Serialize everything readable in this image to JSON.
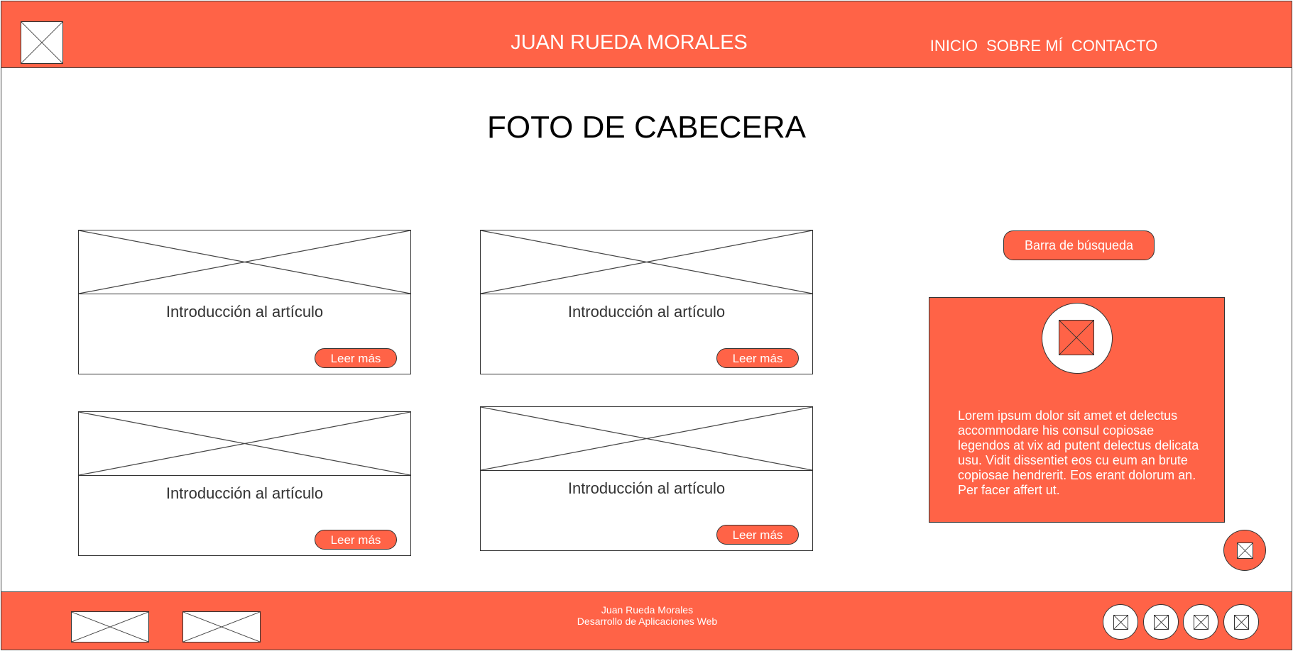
{
  "header": {
    "title": "JUAN RUEDA MORALES",
    "nav": [
      "INICIO",
      "SOBRE MÍ",
      "CONTACTO"
    ]
  },
  "hero": {
    "title": "FOTO DE CABECERA"
  },
  "articles": [
    {
      "intro": "Introducción al artículo",
      "button": "Leer más"
    },
    {
      "intro": "Introducción al artículo",
      "button": "Leer más"
    },
    {
      "intro": "Introducción al artículo",
      "button": "Leer más"
    },
    {
      "intro": "Introducción al artículo",
      "button": "Leer más"
    }
  ],
  "sidebar": {
    "search_label": "Barra de búsqueda",
    "bio": "Lorem ipsum dolor sit amet et delectus accommodare his consul copiosae legendos at vix ad putent delectus delicata usu. Vidit dissentiet eos cu eum an brute copiosae hendrerit. Eos erant dolorum an. Per facer affert ut."
  },
  "footer": {
    "name": "Juan Rueda Morales",
    "subtitle": "Desarrollo de Aplicaciones Web"
  },
  "colors": {
    "accent": "#ff6347",
    "border": "#333333"
  },
  "icons": {
    "logo": "image-placeholder-icon",
    "social": [
      "image-placeholder-icon",
      "image-placeholder-icon",
      "image-placeholder-icon",
      "image-placeholder-icon"
    ]
  }
}
